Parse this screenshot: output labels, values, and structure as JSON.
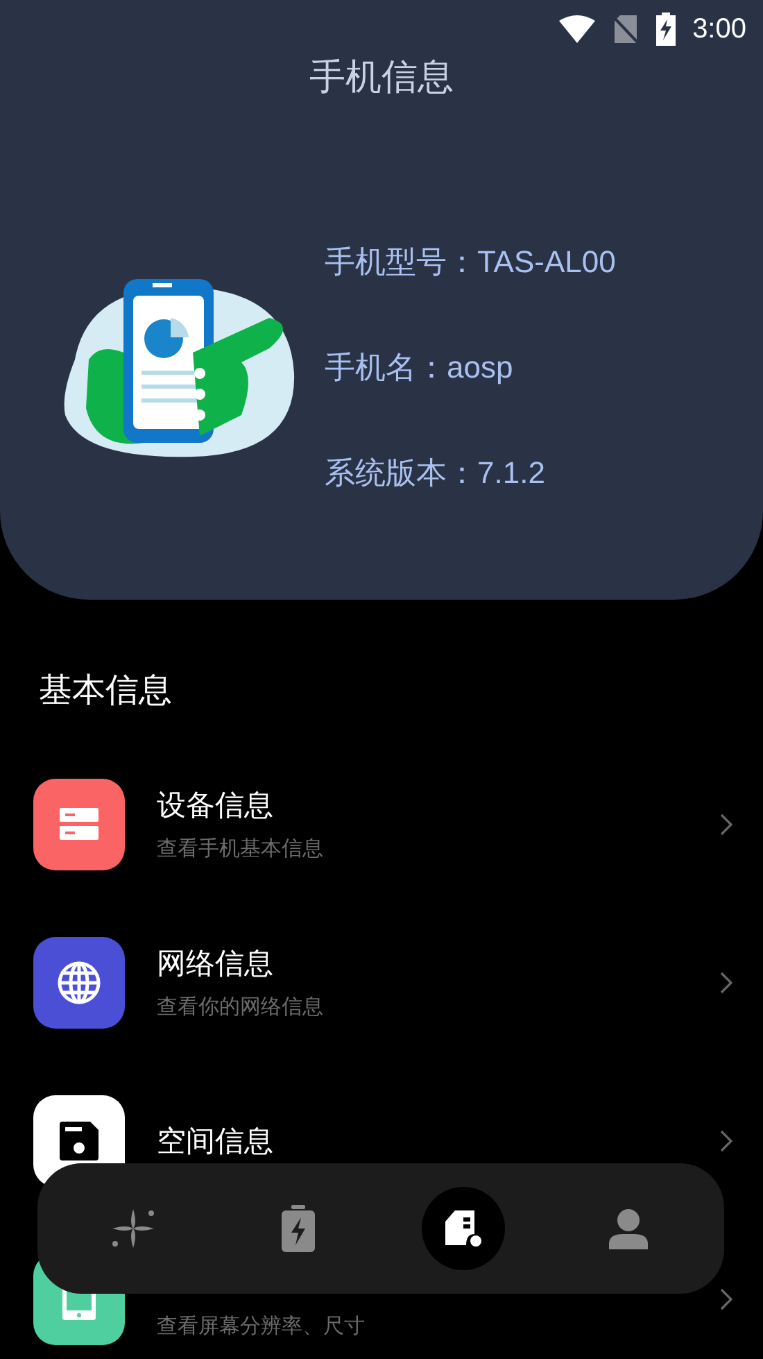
{
  "status_bar": {
    "time": "3:00"
  },
  "header": {
    "title": "手机信息",
    "info": [
      "手机型号：TAS-AL00",
      "手机名：aosp",
      "系统版本：7.1.2"
    ]
  },
  "section_title": "基本信息",
  "items": [
    {
      "title": "设备信息",
      "subtitle": "查看手机基本信息",
      "color": "#fb6464"
    },
    {
      "title": "网络信息",
      "subtitle": "查看你的网络信息",
      "color": "#4b4fd6"
    },
    {
      "title": "空间信息",
      "color": "#ffffff"
    },
    {
      "subtitle": "查看屏幕分辨率、尺寸",
      "color": "#4fcf9f"
    }
  ],
  "nav": [
    {
      "selected": false
    },
    {
      "selected": false
    },
    {
      "selected": true
    },
    {
      "selected": false
    }
  ]
}
